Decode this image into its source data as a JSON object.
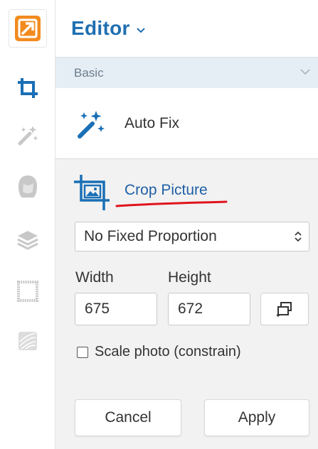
{
  "rail": {
    "items": [
      "logo",
      "crop",
      "magic-wand",
      "hair",
      "layers",
      "frame",
      "texture"
    ]
  },
  "header": {
    "title": "Editor"
  },
  "section": {
    "label": "Basic"
  },
  "autofix": {
    "label": "Auto Fix"
  },
  "crop": {
    "title": "Crop Picture",
    "proportion_value": "No Fixed Proportion",
    "width_label": "Width",
    "height_label": "Height",
    "width_value": "675",
    "height_value": "672",
    "scale_label": "Scale photo (constrain)",
    "scale_checked": false,
    "cancel_label": "Cancel",
    "apply_label": "Apply"
  },
  "colors": {
    "accent": "#1f6fb2",
    "logo_orange": "#f28b1e",
    "underline_red": "#e0141c",
    "section_bg": "#e6eef5",
    "panel_bg": "#f2f2f2"
  }
}
